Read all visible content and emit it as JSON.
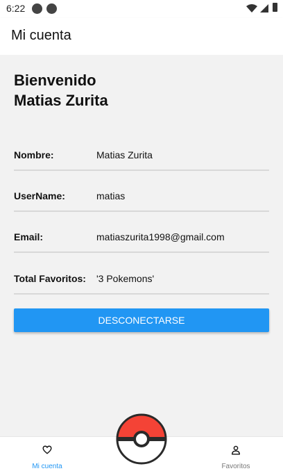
{
  "status_bar": {
    "time": "6:22",
    "icons": [
      "app-notification-icon",
      "app-notification-icon",
      "wifi-icon",
      "signal-icon",
      "battery-icon"
    ]
  },
  "app_bar": {
    "title": "Mi cuenta"
  },
  "profile": {
    "welcome_line1": "Bienvenido",
    "welcome_line2": "Matias Zurita",
    "rows": [
      {
        "label": "Nombre:",
        "value": "Matias Zurita"
      },
      {
        "label": "UserName:",
        "value": "matias"
      },
      {
        "label": "Email:",
        "value": "matiaszurita1998@gmail.com"
      },
      {
        "label": "Total Favoritos:",
        "value": "'3 Pokemons'"
      }
    ],
    "logout_label": "DESCONECTARSE"
  },
  "bottom_nav": {
    "items": [
      {
        "label": "Mi cuenta",
        "icon": "heart-icon",
        "active": true
      },
      {
        "label": "Favoritos",
        "icon": "user-icon",
        "active": false
      }
    ],
    "center_icon": "pokeball-icon"
  },
  "colors": {
    "accent": "#2196f3",
    "background": "#f2f2f2",
    "pokeball_red": "#f44336"
  }
}
